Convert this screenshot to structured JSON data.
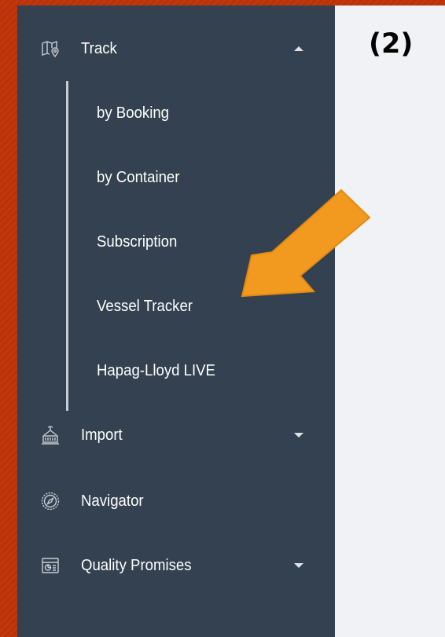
{
  "step_label": "(2)",
  "nav": {
    "track": {
      "label": "Track",
      "icon": "map-pin-icon",
      "expanded": true
    },
    "submenu": [
      {
        "label": "by Booking"
      },
      {
        "label": "by Container"
      },
      {
        "label": "Subscription"
      },
      {
        "label": "Vessel Tracker"
      },
      {
        "label": "Hapag-Lloyd LIVE"
      }
    ],
    "import": {
      "label": "Import",
      "icon": "container-crane-icon",
      "expanded": false
    },
    "navigator": {
      "label": "Navigator",
      "icon": "compass-icon"
    },
    "quality": {
      "label": "Quality Promises",
      "icon": "quality-gauge-icon",
      "expanded": false
    }
  },
  "colors": {
    "sidebar_bg": "#334150",
    "main_bg": "#f1f2f6",
    "frame": "#b93109",
    "arrow": "#f19a1f",
    "text": "#ffffff"
  }
}
